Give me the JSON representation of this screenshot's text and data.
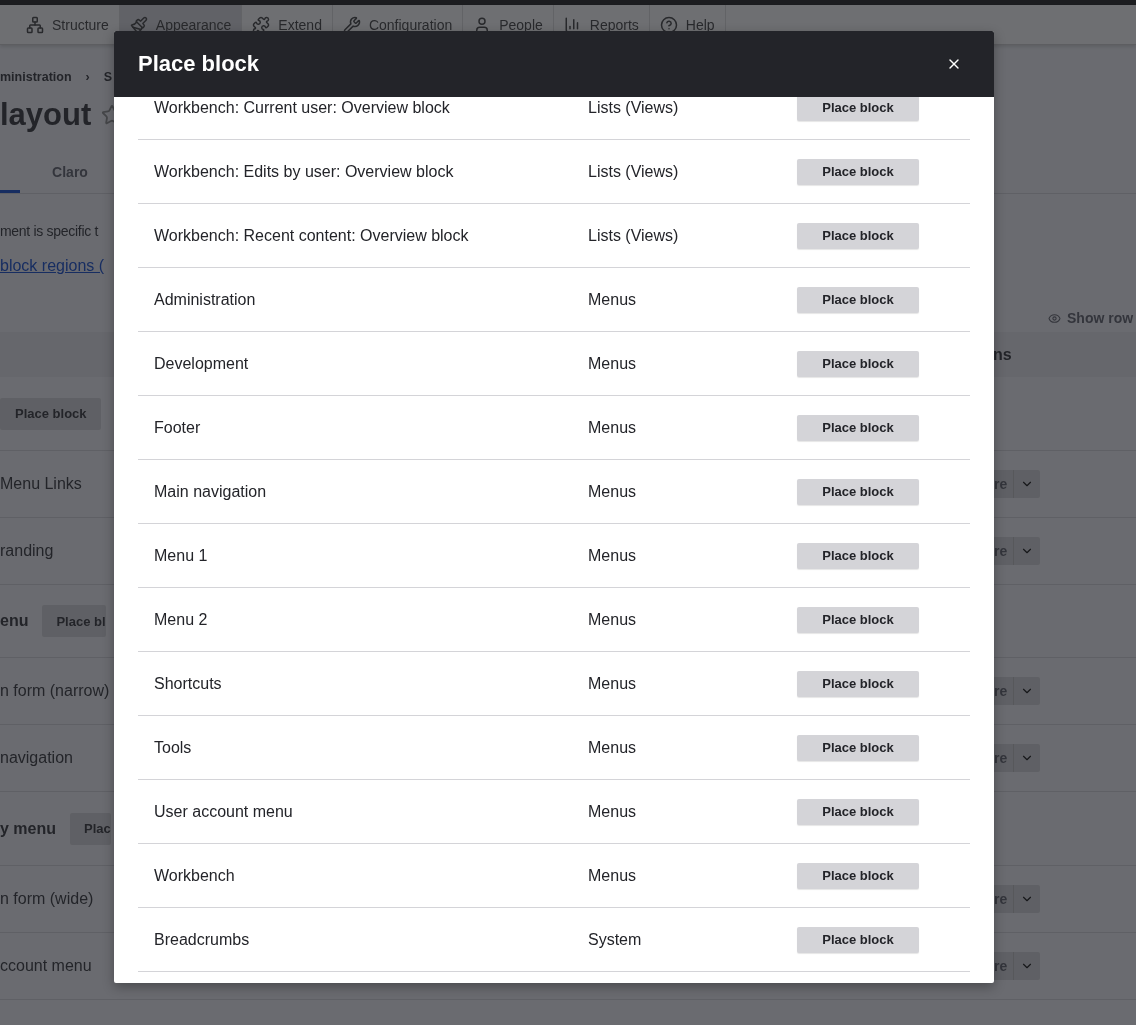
{
  "toolbar": {
    "items": [
      {
        "label": "Structure",
        "selected": false
      },
      {
        "label": "Appearance",
        "selected": true
      },
      {
        "label": "Extend",
        "selected": false
      },
      {
        "label": "Configuration",
        "selected": false
      },
      {
        "label": "People",
        "selected": false
      },
      {
        "label": "Reports",
        "selected": false
      },
      {
        "label": "Help",
        "selected": false
      }
    ]
  },
  "breadcrumb": [
    "ministration",
    "›",
    "S"
  ],
  "page_title": "layout",
  "tabs": [
    {
      "selected": true
    },
    {
      "label": "Claro",
      "selected": false
    }
  ],
  "description": "ment is specific t",
  "regions_link": "block regions (",
  "show_row": "Show row",
  "table": {
    "header": "ns",
    "rows": [
      {
        "kind": "region",
        "button": "Place block"
      },
      {
        "kind": "block",
        "label": "Menu Links",
        "button": "re"
      },
      {
        "kind": "block",
        "label": "randing",
        "button": "re"
      },
      {
        "kind": "region",
        "label": "enu",
        "button": "Place bl"
      },
      {
        "kind": "block",
        "label": "n form (narrow)",
        "button": "re"
      },
      {
        "kind": "block",
        "label": "navigation",
        "button": "re"
      },
      {
        "kind": "region",
        "label": "y menu",
        "button": "Plac"
      },
      {
        "kind": "block",
        "label": "n form (wide)",
        "button": "re"
      },
      {
        "kind": "block",
        "label": "ccount menu",
        "button": "re"
      }
    ]
  },
  "dialog": {
    "title": "Place block",
    "rows": [
      {
        "name": "Workbench: Current user: Overview block",
        "category": "Lists (Views)",
        "button": "Place block"
      },
      {
        "name": "Workbench: Edits by user: Overview block",
        "category": "Lists (Views)",
        "button": "Place block"
      },
      {
        "name": "Workbench: Recent content: Overview block",
        "category": "Lists (Views)",
        "button": "Place block"
      },
      {
        "name": "Administration",
        "category": "Menus",
        "button": "Place block"
      },
      {
        "name": "Development",
        "category": "Menus",
        "button": "Place block"
      },
      {
        "name": "Footer",
        "category": "Menus",
        "button": "Place block"
      },
      {
        "name": "Main navigation",
        "category": "Menus",
        "button": "Place block"
      },
      {
        "name": "Menu 1",
        "category": "Menus",
        "button": "Place block"
      },
      {
        "name": "Menu 2",
        "category": "Menus",
        "button": "Place block"
      },
      {
        "name": "Shortcuts",
        "category": "Menus",
        "button": "Place block"
      },
      {
        "name": "Tools",
        "category": "Menus",
        "button": "Place block"
      },
      {
        "name": "User account menu",
        "category": "Menus",
        "button": "Place block"
      },
      {
        "name": "Workbench",
        "category": "Menus",
        "button": "Place block"
      },
      {
        "name": "Breadcrumbs",
        "category": "System",
        "button": "Place block"
      }
    ]
  }
}
